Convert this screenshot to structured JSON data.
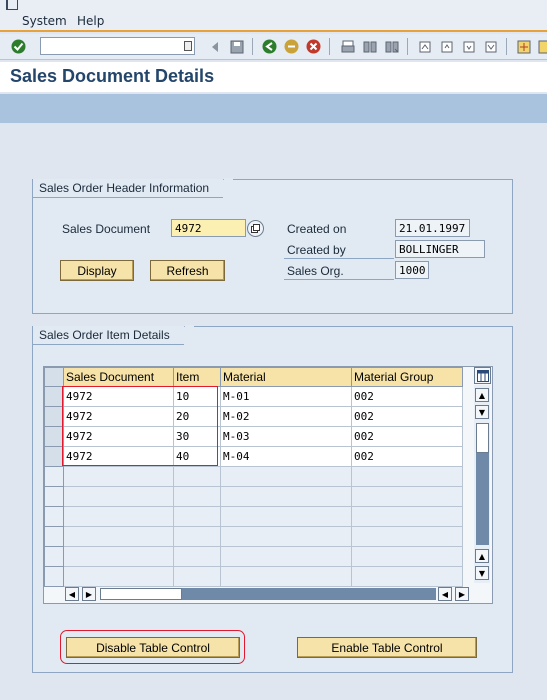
{
  "menu": {
    "system": "System",
    "help": "Help"
  },
  "toolbar": {
    "command_field": ""
  },
  "title": "Sales Document Details",
  "header_group": {
    "title": "Sales Order Header Information",
    "sales_document_label": "Sales Document",
    "sales_document_value": "4972",
    "display_button": "Display",
    "refresh_button": "Refresh",
    "created_on_label": "Created on",
    "created_on_value": "21.01.1997",
    "created_by_label": "Created by",
    "created_by_value": "BOLLINGER",
    "sales_org_label": "Sales Org.",
    "sales_org_value": "1000"
  },
  "items_group": {
    "title": "Sales Order Item Details",
    "columns": [
      "Sales Document",
      "Item",
      "Material",
      "Material Group"
    ],
    "rows": [
      [
        "4972",
        "10",
        "M-01",
        "002"
      ],
      [
        "4972",
        "20",
        "M-02",
        "002"
      ],
      [
        "4972",
        "30",
        "M-03",
        "002"
      ],
      [
        "4972",
        "40",
        "M-04",
        "002"
      ]
    ]
  },
  "buttons": {
    "disable": "Disable Table Control",
    "enable": "Enable Table Control"
  },
  "colors": {
    "accent": "#e8a23c",
    "title": "#24466b",
    "button": "#f6e3a9",
    "highlight": "#e0192e"
  }
}
